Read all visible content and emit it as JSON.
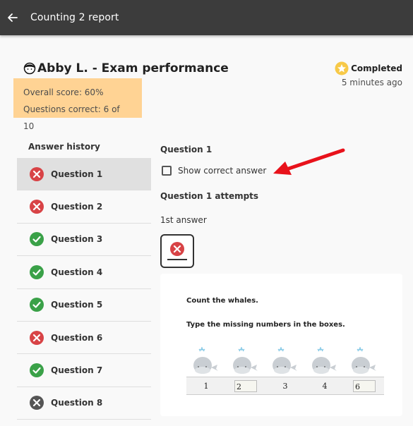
{
  "appbar": {
    "title": "Counting 2 report",
    "back_icon": "arrow-left-icon"
  },
  "learner": {
    "name": "Abby L. - Exam performance",
    "icon": "person-icon"
  },
  "score": {
    "overall": "Overall score: 60%",
    "correct": "Questions correct: 6 of 10"
  },
  "status": {
    "label": "Completed",
    "time": "5 minutes ago",
    "icon": "star-icon"
  },
  "history": {
    "title": "Answer history",
    "items": [
      {
        "label": "Question 1",
        "result": "incorrect"
      },
      {
        "label": "Question 2",
        "result": "incorrect"
      },
      {
        "label": "Question 3",
        "result": "correct"
      },
      {
        "label": "Question 4",
        "result": "correct"
      },
      {
        "label": "Question 5",
        "result": "correct"
      },
      {
        "label": "Question 6",
        "result": "incorrect"
      },
      {
        "label": "Question 7",
        "result": "correct"
      },
      {
        "label": "Question 8",
        "result": "unanswered"
      }
    ]
  },
  "question": {
    "title": "Question 1",
    "show_correct": "Show correct answer",
    "attempts_title": "Question 1 attempts",
    "first_answer": "1st answer"
  },
  "exercise": {
    "instruction1": "Count the whales.",
    "instruction2": "Type the missing numbers in the boxes.",
    "numbers": [
      "1",
      "2",
      "3",
      "4",
      "6"
    ]
  },
  "colors": {
    "incorrect": "#d84346",
    "correct": "#3aa148",
    "unanswered": "#555555",
    "highlight": "#ffd394",
    "appbar": "#3c3c3c",
    "star": "#f7c948"
  }
}
